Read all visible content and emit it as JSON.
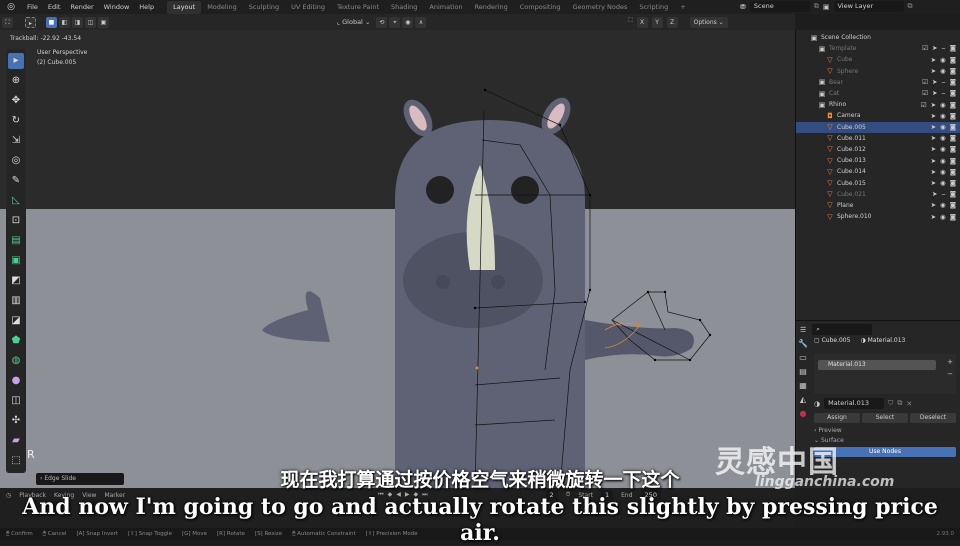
{
  "menu": [
    "File",
    "Edit",
    "Render",
    "Window",
    "Help"
  ],
  "workspaces": [
    {
      "label": "Layout",
      "active": true
    },
    {
      "label": "Modeling",
      "active": false
    },
    {
      "label": "Sculpting",
      "active": false
    },
    {
      "label": "UV Editing",
      "active": false
    },
    {
      "label": "Texture Paint",
      "active": false
    },
    {
      "label": "Shading",
      "active": false
    },
    {
      "label": "Animation",
      "active": false
    },
    {
      "label": "Rendering",
      "active": false
    },
    {
      "label": "Compositing",
      "active": false
    },
    {
      "label": "Geometry Nodes",
      "active": false
    },
    {
      "label": "Scripting",
      "active": false
    }
  ],
  "scene": {
    "label": "Scene",
    "view_layer": "View Layer"
  },
  "header": {
    "orientation": "Global",
    "axes": [
      "X",
      "Y",
      "Z"
    ],
    "options": "Options"
  },
  "viewport": {
    "trackball": "Trackball: -22.92 -43.54",
    "perspective": "User Perspective",
    "object": "(2) Cube.005",
    "operator": "Edge Slide",
    "key_hint": "R"
  },
  "outliner": {
    "root": "Scene Collection",
    "rows": [
      {
        "name": "Template",
        "type": "collection",
        "dim": true,
        "selected": false
      },
      {
        "name": "Cube",
        "type": "object",
        "dim": true,
        "selected": false
      },
      {
        "name": "Sphere",
        "type": "object",
        "dim": true,
        "selected": false
      },
      {
        "name": "Bear",
        "type": "collection",
        "dim": true,
        "selected": false
      },
      {
        "name": "Cat",
        "type": "collection",
        "dim": true,
        "selected": false
      },
      {
        "name": "Rhino",
        "type": "collection",
        "dim": false,
        "selected": false
      },
      {
        "name": "Camera",
        "type": "camera",
        "dim": false,
        "selected": false
      },
      {
        "name": "Cube.005",
        "type": "object",
        "dim": false,
        "selected": true
      },
      {
        "name": "Cube.011",
        "type": "object",
        "dim": false,
        "selected": false
      },
      {
        "name": "Cube.012",
        "type": "object",
        "dim": false,
        "selected": false
      },
      {
        "name": "Cube.013",
        "type": "object",
        "dim": false,
        "selected": false
      },
      {
        "name": "Cube.014",
        "type": "object",
        "dim": false,
        "selected": false
      },
      {
        "name": "Cube.015",
        "type": "object",
        "dim": false,
        "selected": false
      },
      {
        "name": "Cube.021",
        "type": "object",
        "dim": true,
        "selected": false
      },
      {
        "name": "Plane",
        "type": "object",
        "dim": false,
        "selected": false
      },
      {
        "name": "Sphere.010",
        "type": "object",
        "dim": false,
        "selected": false
      }
    ]
  },
  "properties": {
    "object": "Cube.005",
    "material": "Material.013",
    "slot": "Material.013",
    "material_field": "Material.013",
    "buttons": [
      "Assign",
      "Select",
      "Deselect"
    ],
    "sections": [
      "Preview",
      "Surface"
    ],
    "use_nodes": "Use Nodes"
  },
  "timeline": {
    "menus": [
      "Playback",
      "Keying",
      "View",
      "Marker"
    ],
    "current_frame": "2",
    "start_label": "Start",
    "start": "1",
    "end_label": "End",
    "end": "250"
  },
  "statusbar": {
    "items": [
      "Confirm",
      "Cancel",
      "Snap Invert",
      "Snap Toggle",
      "Move",
      "Rotate",
      "Resize",
      "Automatic Constraint",
      "Precision Mode"
    ],
    "version": "2.93.0"
  },
  "subtitles": {
    "cn": "现在我打算通过按价格空气来稍微旋转一下这个",
    "en": "And now I'm going to go and actually rotate this slightly by pressing price air."
  },
  "watermark": {
    "cn": "灵感中国",
    "url": "lingganchina.com"
  },
  "colors": {
    "accent": "#4772b3",
    "selected_row": "#334d80",
    "object_icon": "#f08d3a"
  }
}
